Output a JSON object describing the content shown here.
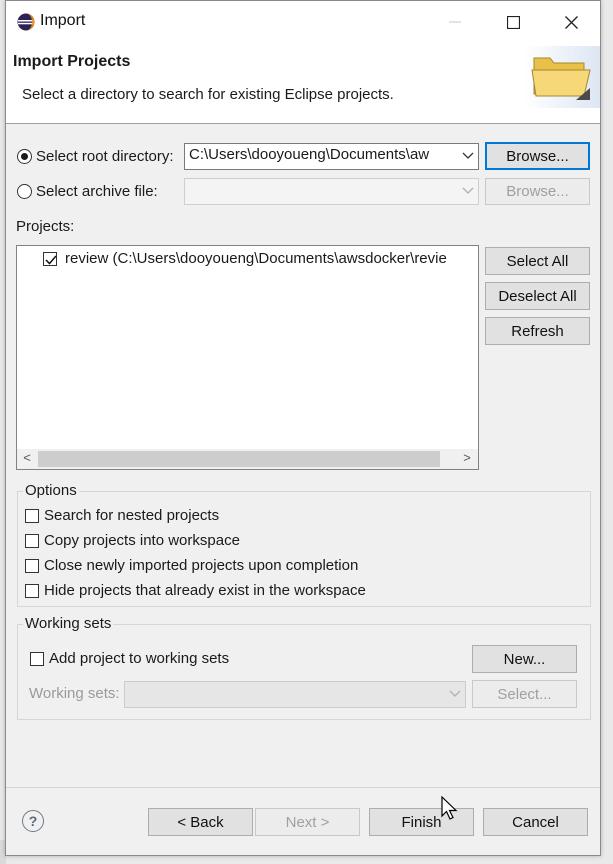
{
  "window": {
    "title": "Import",
    "minimize": "—",
    "maximize": "☐",
    "close": "✕"
  },
  "banner": {
    "title": "Import Projects",
    "description": "Select a directory to search for existing Eclipse projects."
  },
  "source": {
    "root_label": "Select root directory:",
    "root_value": "C:\\Users\\dooyoueng\\Documents\\aw",
    "browse_root": "Browse...",
    "archive_label": "Select archive file:",
    "archive_value": "",
    "browse_archive": "Browse..."
  },
  "projects": {
    "label": "Projects:",
    "items": [
      {
        "label": "review (C:\\Users\\dooyoueng\\Documents\\awsdocker\\revie",
        "checked": true
      }
    ],
    "select_all": "Select All",
    "deselect_all": "Deselect All",
    "refresh": "Refresh",
    "scroll_left": "<",
    "scroll_right": ">"
  },
  "options": {
    "legend": "Options",
    "nested": "Search for nested projects",
    "copy": "Copy projects into workspace",
    "close": "Close newly imported projects upon completion",
    "hide": "Hide projects that already exist in the workspace"
  },
  "working_sets": {
    "legend": "Working sets",
    "add_label": "Add project to working sets",
    "new_button": "New...",
    "sets_label": "Working sets:",
    "sets_value": "",
    "select_button": "Select..."
  },
  "footer": {
    "help": "?",
    "back": "< Back",
    "next": "Next >",
    "finish": "Finish",
    "cancel": "Cancel"
  },
  "colors": {
    "focus": "#0078d7",
    "button": "#e1e1e1",
    "dialog": "#f0f0f0",
    "disabled_text": "#a0a0a0"
  },
  "icons": {
    "app": "eclipse-icon",
    "banner": "folder-icon",
    "help": "help-icon"
  }
}
